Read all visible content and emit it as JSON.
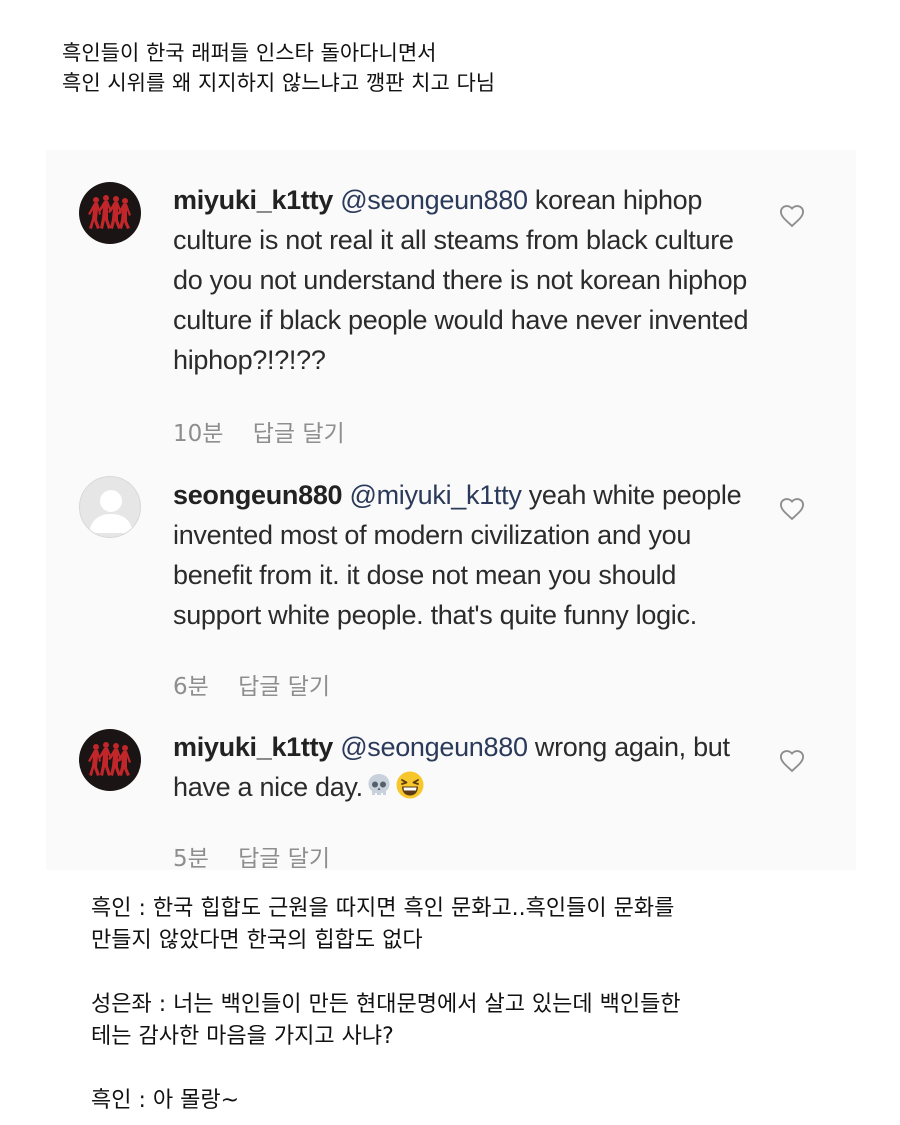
{
  "intro": {
    "line1": "흑인들이 한국 래퍼들 인스타 돌아다니면서",
    "line2": "흑인 시위를 왜 지지하지 않느냐고 깽판 치고 다님"
  },
  "comments": [
    {
      "username": "miyuki_k1tty",
      "mention": "@seongeun880",
      "text": "korean hiphop culture is not real it all steams from black culture do you not understand there is not korean hiphop culture if black people would have never invented hiphop?!?!??",
      "time": "10분",
      "reply_label": "답글 달기",
      "avatar": "dancers-silhouette-avatar"
    },
    {
      "username": "seongeun880",
      "mention": "@miyuki_k1tty",
      "text": "yeah white people invented most of modern civilization and you benefit from it. it dose not mean you should support white people. that's quite funny logic.",
      "time": "6분",
      "reply_label": "답글 달기",
      "avatar": "default-user-avatar"
    },
    {
      "username": "miyuki_k1tty",
      "mention": "@seongeun880",
      "text": "wrong again, but have a nice day.",
      "emojis": [
        "skull-emoji",
        "grinning-squint-emoji"
      ],
      "time": "5분",
      "reply_label": "답글 달기",
      "avatar": "dancers-silhouette-avatar"
    }
  ],
  "dialogue": [
    {
      "line1": "흑인 : 한국 힙합도 근원을 따지면 흑인 문화고..흑인들이 문화를",
      "line2": "만들지 않았다면 한국의 힙합도 없다"
    },
    {
      "line1": "성은좌 : 너는 백인들이 만든 현대문명에서 살고 있는데 백인들한",
      "line2": "테는 감사한 마음을 가지고 사냐?"
    },
    {
      "line1": "흑인 : 아 몰랑~"
    }
  ],
  "colors": {
    "panel_background": "#fafafa",
    "meta_gray": "#8e8e8e",
    "avatar_red": "#c0262a"
  }
}
